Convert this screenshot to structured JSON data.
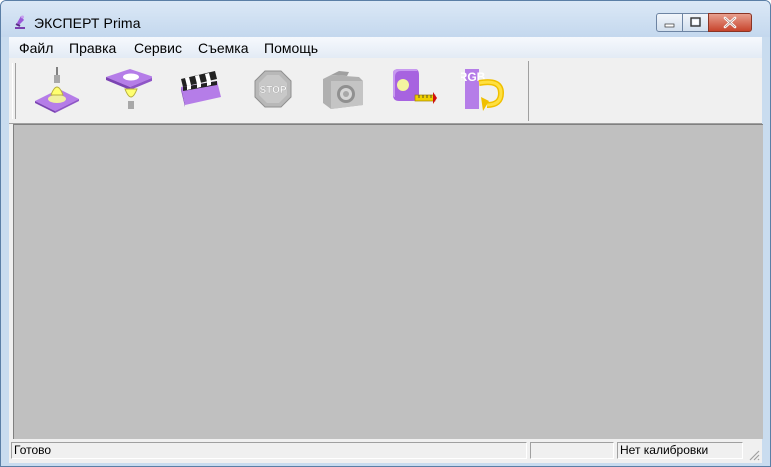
{
  "window": {
    "title": "ЭКСПЕРТ Prima",
    "app_icon": "microscope-icon",
    "controls": [
      "minimize-icon",
      "maximize-icon",
      "close-icon"
    ]
  },
  "menu": {
    "items": [
      {
        "label": "Файл"
      },
      {
        "label": "Правка"
      },
      {
        "label": "Сервис"
      },
      {
        "label": "Съемка"
      },
      {
        "label": "Помощь"
      }
    ]
  },
  "toolbar": {
    "buttons": [
      {
        "icon": "lamp-bottom-light-icon",
        "enabled": true
      },
      {
        "icon": "lamp-top-light-icon",
        "enabled": true
      },
      {
        "icon": "clapperboard-icon",
        "enabled": true
      },
      {
        "icon": "stop-icon",
        "enabled": false,
        "label": "STOP"
      },
      {
        "icon": "camera-icon",
        "enabled": false
      },
      {
        "icon": "calibration-ruler-icon",
        "enabled": true
      },
      {
        "icon": "rgb-rotate-icon",
        "enabled": true,
        "label": "RGB"
      }
    ]
  },
  "status": {
    "left": "Готово",
    "middle": "",
    "right": "Нет калибровки"
  },
  "colors": {
    "workspace": "#c0c0c0",
    "accent_purple": "#a56be0",
    "titlebar": "#c9dcef"
  }
}
